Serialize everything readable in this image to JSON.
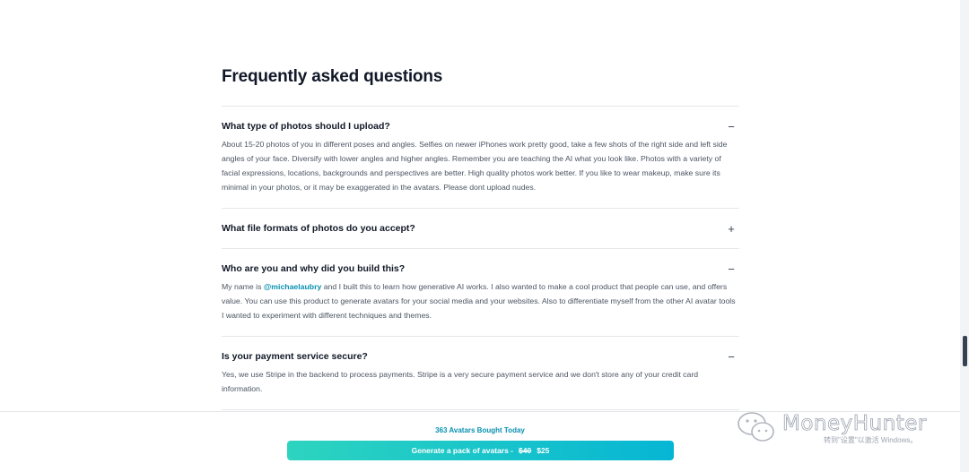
{
  "faq": {
    "title": "Frequently asked questions",
    "items": [
      {
        "question": "What type of photos should I upload?",
        "toggle": "−",
        "answer": "About 15-20 photos of you in different poses and angles. Selfies on newer iPhones work pretty good, take a few shots of the right side and left side angles of your face. Diversify with lower angles and higher angles. Remember you are teaching the AI what you look like. Photos with a variety of facial expressions, locations, backgrounds and perspectives are better. High quality photos work better. If you like to wear makeup, make sure its minimal in your photos, or it may be exaggerated in the avatars. Please dont upload nudes."
      },
      {
        "question": "What file formats of photos do you accept?",
        "toggle": "+"
      },
      {
        "question": "Who are you and why did you build this?",
        "toggle": "−",
        "answer_prefix": "My name is ",
        "answer_link": "@michaelaubry",
        "answer_suffix": " and I built this to learn how generative AI works. I also wanted to make a cool product that people can use, and offers value. You can use this product to generate avatars for your social media and your websites. Also to differentiate myself from the other AI avatar tools I wanted to experiment with different techniques and themes."
      },
      {
        "question": "Is your payment service secure?",
        "toggle": "−",
        "answer": "Yes, we use Stripe in the backend to process payments. Stripe is a very secure payment service and we don't store any of your credit card information."
      }
    ]
  },
  "footer": {
    "bought_text": "363 Avatars Bought Today",
    "cta_label": "Generate a pack of avatars -",
    "old_price": "$40",
    "new_price": "$25",
    "accent_color": "#0891b2"
  },
  "watermark": {
    "name": "MoneyHunter",
    "sub": "转到\"设置\"以激活 Windows。"
  }
}
